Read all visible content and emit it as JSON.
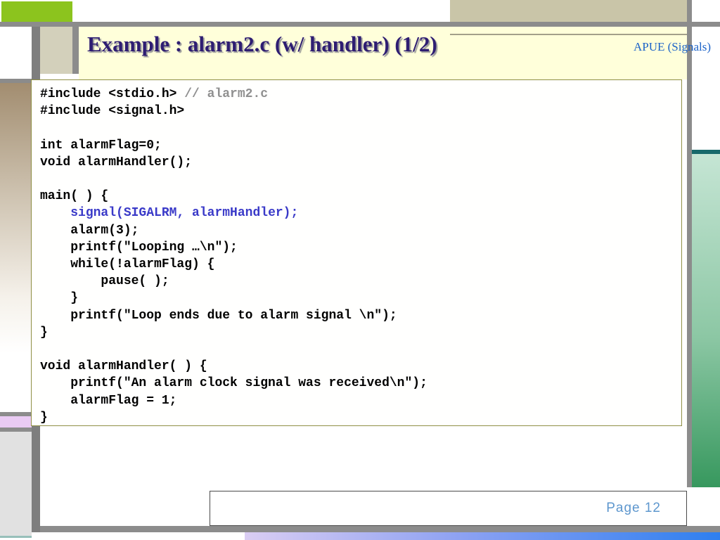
{
  "slide": {
    "title": "Example : alarm2.c (w/ handler) (1/2)",
    "header_badge": "APUE (Signals)",
    "footer": {
      "page_label": "Page 12"
    }
  },
  "colors": {
    "title_text": "#2e1d72",
    "badge_blue": "#1c63c8",
    "page_label_blue": "#5e97ce",
    "code_call_blue": "#3a3ac8",
    "code_comment_gray": "#909090",
    "accent_green_block": "#8cc41e",
    "accent_tan": "#c9c5a8",
    "accent_lavender": "#eacbf4",
    "accent_teal": "#17696b",
    "gradient_green_bottom": "#37985e",
    "gradient_bar_blue": "#2e7ff0"
  },
  "code_block": {
    "lines": [
      [
        {
          "t": "#include <stdio.h> ",
          "c": "k"
        },
        {
          "t": "// alarm2.c",
          "c": "comment"
        }
      ],
      [
        {
          "t": "#include <signal.h>",
          "c": "k"
        }
      ],
      [],
      [
        {
          "t": "int alarmFlag=0;",
          "c": "k"
        }
      ],
      [
        {
          "t": "void alarmHandler();",
          "c": "k"
        }
      ],
      [],
      [
        {
          "t": "main( ) {",
          "c": "k"
        }
      ],
      [
        {
          "t": "    ",
          "c": "k"
        },
        {
          "t": "signal(SIGALRM, alarmHandler);",
          "c": "call"
        }
      ],
      [
        {
          "t": "    alarm(3);",
          "c": "k"
        }
      ],
      [
        {
          "t": "    printf(\"Looping …\\n\");",
          "c": "k"
        }
      ],
      [
        {
          "t": "    while(!alarmFlag) {",
          "c": "k"
        }
      ],
      [
        {
          "t": "        pause( );",
          "c": "k"
        }
      ],
      [
        {
          "t": "    }",
          "c": "k"
        }
      ],
      [
        {
          "t": "    printf(\"Loop ends due to alarm signal \\n\");",
          "c": "k"
        }
      ],
      [
        {
          "t": "}",
          "c": "k"
        }
      ],
      [],
      [
        {
          "t": "void alarmHandler( ) {",
          "c": "k"
        }
      ],
      [
        {
          "t": "    printf(\"An alarm clock signal was received\\n\");",
          "c": "k"
        }
      ],
      [
        {
          "t": "    alarmFlag = 1;",
          "c": "k"
        }
      ],
      [
        {
          "t": "}",
          "c": "k"
        }
      ]
    ]
  }
}
